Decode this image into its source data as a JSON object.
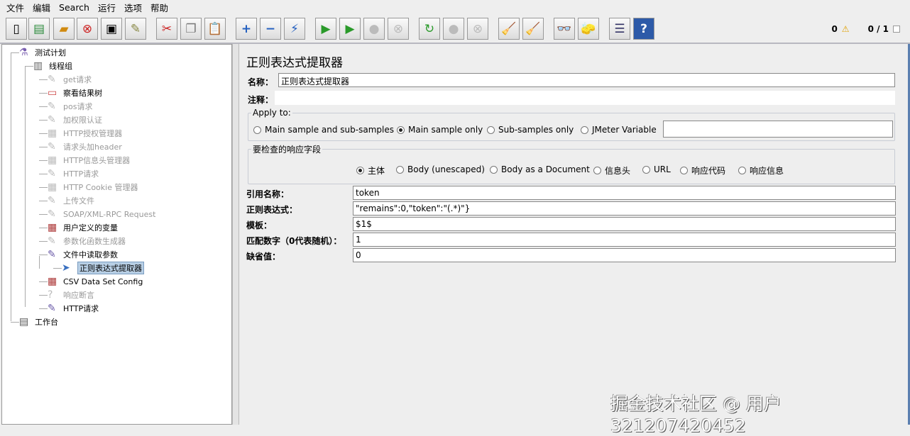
{
  "menu": [
    "文件",
    "编辑",
    "Search",
    "运行",
    "选项",
    "帮助"
  ],
  "toolbar": {
    "error_count": "0",
    "threads": "0 / 1"
  },
  "tree": [
    {
      "label": "测试计划",
      "dis": false,
      "icon": "test-plan-icon"
    },
    {
      "label": "线程组",
      "dis": false,
      "icon": "thread-group-icon"
    },
    {
      "label": "get请求",
      "dis": true,
      "icon": "sampler-icon"
    },
    {
      "label": "察看结果树",
      "dis": false,
      "icon": "listener-icon"
    },
    {
      "label": "pos请求",
      "dis": true,
      "icon": "sampler-icon"
    },
    {
      "label": "加权限认证",
      "dis": true,
      "icon": "sampler-icon"
    },
    {
      "label": "HTTP授权管理器",
      "dis": true,
      "icon": "config-icon"
    },
    {
      "label": "请求头加header",
      "dis": true,
      "icon": "sampler-icon"
    },
    {
      "label": "HTTP信息头管理器",
      "dis": true,
      "icon": "config-icon"
    },
    {
      "label": "HTTP请求",
      "dis": true,
      "icon": "sampler-icon"
    },
    {
      "label": "HTTP Cookie 管理器",
      "dis": true,
      "icon": "config-icon"
    },
    {
      "label": "上传文件",
      "dis": true,
      "icon": "sampler-icon"
    },
    {
      "label": "SOAP/XML-RPC Request",
      "dis": true,
      "icon": "sampler-icon"
    },
    {
      "label": "用户定义的变量",
      "dis": false,
      "icon": "config-icon"
    },
    {
      "label": "参数化函数生成器",
      "dis": true,
      "icon": "sampler-icon"
    },
    {
      "label": "文件中读取参数",
      "dis": false,
      "icon": "sampler-icon"
    },
    {
      "label": "正则表达式提取器",
      "dis": false,
      "icon": "extractor-icon"
    },
    {
      "label": "CSV Data Set Config",
      "dis": false,
      "icon": "config-icon"
    },
    {
      "label": "响应断言",
      "dis": true,
      "icon": "assertion-icon"
    },
    {
      "label": "HTTP请求",
      "dis": false,
      "icon": "sampler-icon"
    },
    {
      "label": "工作台",
      "dis": false,
      "icon": "workbench-icon"
    }
  ],
  "panel": {
    "title": "正则表达式提取器",
    "name_label": "名称：",
    "name_value": "正则表达式提取器",
    "comment_label": "注释：",
    "comment_value": "",
    "apply_to": {
      "legend": "Apply to:",
      "options": [
        "Main sample and sub-samples",
        "Main sample only",
        "Sub-samples only",
        "JMeter Variable"
      ],
      "selected": 1,
      "variable_value": ""
    },
    "field": {
      "legend": "要检查的响应字段",
      "options": [
        "主体",
        "Body (unescaped)",
        "Body as a Document",
        "信息头",
        "URL",
        "响应代码",
        "响应信息"
      ],
      "selected": 0
    },
    "rows": [
      {
        "label": "引用名称：",
        "value": "token"
      },
      {
        "label": "正则表达式：",
        "value": "\"remains\":0,\"token\":\"(.*)\"}"
      },
      {
        "label": "模板：",
        "value": "$1$"
      },
      {
        "label": "匹配数字（0代表随机）：",
        "value": "1"
      },
      {
        "label": "缺省值：",
        "value": "0"
      }
    ]
  },
  "watermark": "掘金技术社区 @ 用户321207420452"
}
